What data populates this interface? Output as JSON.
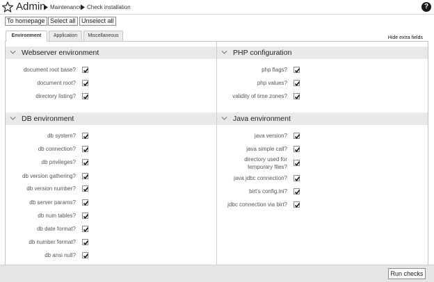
{
  "header": {
    "app_title": "Admin",
    "breadcrumb": [
      "Maintenance",
      "Check installation"
    ],
    "help_glyph": "?"
  },
  "toolbar": {
    "to_homepage": "To homepage",
    "select_all": "Select all",
    "unselect_all": "Unselect all"
  },
  "tabs": [
    {
      "label": "Environment",
      "active": true
    },
    {
      "label": "Application",
      "active": false
    },
    {
      "label": "Miscellaneous",
      "active": false
    }
  ],
  "hide_extra_fields": "Hide extra fields",
  "sections": {
    "webserver": {
      "title": "Webserver environment",
      "items": [
        {
          "label": "document root base?",
          "checked": true
        },
        {
          "label": "document root?",
          "checked": true
        },
        {
          "label": "directory listing?",
          "checked": true
        }
      ]
    },
    "php": {
      "title": "PHP configuration",
      "items": [
        {
          "label": "php flags?",
          "checked": true
        },
        {
          "label": "php values?",
          "checked": true
        },
        {
          "label": "validity of time zones?",
          "checked": true
        }
      ]
    },
    "db": {
      "title": "DB environment",
      "items": [
        {
          "label": "db system?",
          "checked": true
        },
        {
          "label": "db connection?",
          "checked": true
        },
        {
          "label": "db privileges?",
          "checked": true
        },
        {
          "label": "db version gathering?",
          "checked": true
        },
        {
          "label": "db version number?",
          "checked": true
        },
        {
          "label": "db server params?",
          "checked": true
        },
        {
          "label": "db num tables?",
          "checked": true
        },
        {
          "label": "db date format?",
          "checked": true
        },
        {
          "label": "db number format?",
          "checked": true
        },
        {
          "label": "db ansi null?",
          "checked": true
        }
      ]
    },
    "java": {
      "title": "Java environment",
      "items": [
        {
          "label": "java version?",
          "checked": true
        },
        {
          "label": "java simple call?",
          "checked": true
        },
        {
          "label": "directory used for",
          "label2": "temporary files?",
          "checked": true
        },
        {
          "label": "java jdbc connection?",
          "checked": true
        },
        {
          "label": "birt's config.ini?",
          "checked": true
        },
        {
          "label": "jdbc connection via birt?",
          "checked": true
        }
      ]
    }
  },
  "footer": {
    "run_checks": "Run checks"
  }
}
